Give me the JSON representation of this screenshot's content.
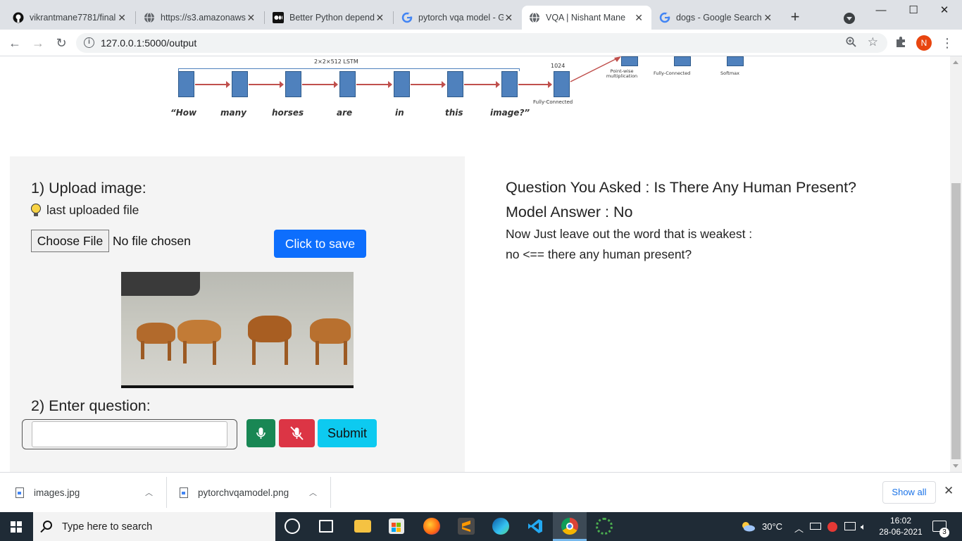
{
  "browser": {
    "tabs": [
      {
        "title": "vikrantmane7781/final",
        "icon": "github-icon"
      },
      {
        "title": "https://s3.amazonaws.",
        "icon": "globe-icon"
      },
      {
        "title": "Better Python depende",
        "icon": "medium-icon"
      },
      {
        "title": "pytorch vqa model - G",
        "icon": "google-icon"
      },
      {
        "title": "VQA | Nishant Mane",
        "icon": "globe-icon",
        "active": true
      },
      {
        "title": "dogs - Google Search",
        "icon": "google-icon"
      }
    ],
    "close_glyph": "✕",
    "new_tab_glyph": "+",
    "url": "127.0.0.1:5000/output",
    "profile_initial": "N",
    "window": {
      "minimize": "—",
      "maximize": "☐",
      "close": "✕"
    }
  },
  "diagram": {
    "lstm_label": "2×2×512 LSTM",
    "fc_size": "1024",
    "fc_label": "Fully-Connected",
    "pointwise_label": "Point-wise multiplication",
    "fc2_label": "Fully-Connected",
    "softmax_label": "Softmax",
    "words": [
      "“How",
      "many",
      "horses",
      "are",
      "in",
      "this",
      "image?”"
    ]
  },
  "upload": {
    "heading": "1) Upload image:",
    "last_file": "last uploaded file",
    "choose_file": "Choose File",
    "no_file": "No file chosen",
    "save_button": "Click to save"
  },
  "question": {
    "heading": "2) Enter question:",
    "input_value": "",
    "submit_button": "Submit"
  },
  "result": {
    "asked": "Question You Asked : Is There Any Human Present?",
    "answer": "Model Answer : No",
    "hint": "Now Just leave out the word that is weakest :",
    "derived": "no <== there any human present?"
  },
  "downloads": {
    "items": [
      "images.jpg",
      "pytorchvqamodel.png"
    ],
    "show_all": "Show all"
  },
  "taskbar": {
    "search_placeholder": "Type here to search",
    "temperature": "30°C",
    "time": "16:02",
    "date": "28-06-2021",
    "notifications": "3"
  },
  "colors": {
    "primary": "#0d6efd",
    "success": "#198754",
    "danger": "#dc3545",
    "info": "#0dcaf0",
    "panel": "#f4f4f4"
  }
}
